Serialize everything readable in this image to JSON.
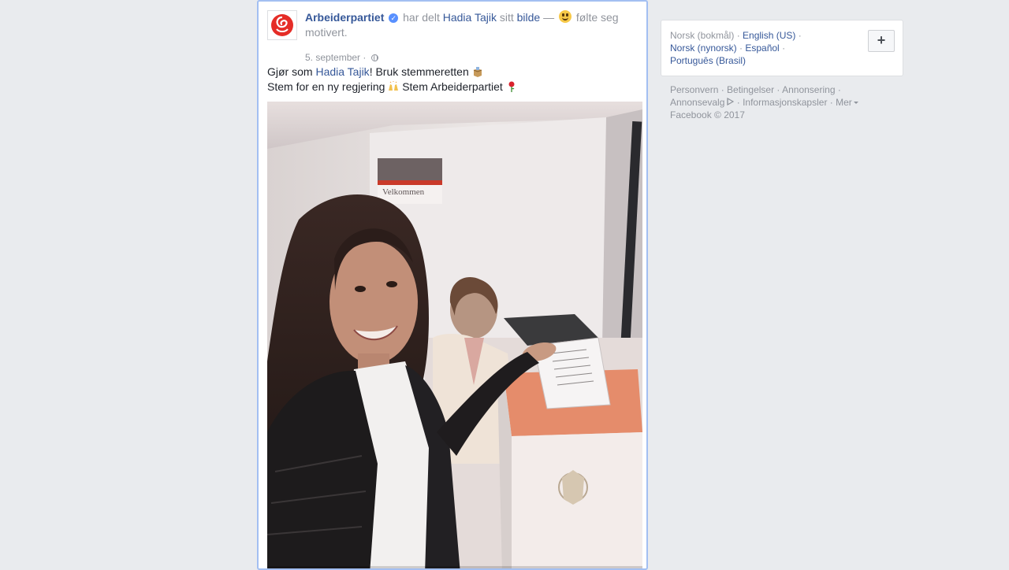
{
  "post": {
    "page_name": "Arbeiderpartiet",
    "verified_icon": "check-badge-icon",
    "shared_text": " har delt ",
    "shared_person": "Hadia Tajik",
    "possessive": " sitt ",
    "photo_link": "bilde",
    "dash": " — ",
    "feeling_text": " følte seg motivert.",
    "date": "5. september",
    "dot": " · ",
    "privacy_icon": "globe-icon",
    "text_line1_prefix": "Gjør som ",
    "text_line1_mention": "Hadia Tajik",
    "text_line1_suffix": "! Bruk stemmeretten ",
    "text_line2_prefix": "Stem for en ny regjering ",
    "text_line2_suffix": " Stem Arbeiderpartiet ",
    "emoji_ballot_box": "ballot-box-icon",
    "emoji_raised_hands": "raised-hands-icon",
    "emoji_rose": "rose-icon",
    "booth_sign": "Velkommen"
  },
  "languages": {
    "current": "Norsk (bokmål)",
    "items": [
      "English (US)",
      "Norsk (nynorsk)",
      "Español",
      "Português (Brasil)"
    ],
    "add_label": "+"
  },
  "footer": {
    "links": [
      "Personvern",
      "Betingelser",
      "Annonsering",
      "Annonsevalg",
      "Informasjonskapsler",
      "Mer"
    ],
    "copyright": "Facebook © 2017"
  },
  "colors": {
    "link": "#365899",
    "muted": "#90949c",
    "background": "#e9ebee",
    "selected_border": "#a3bff2"
  }
}
